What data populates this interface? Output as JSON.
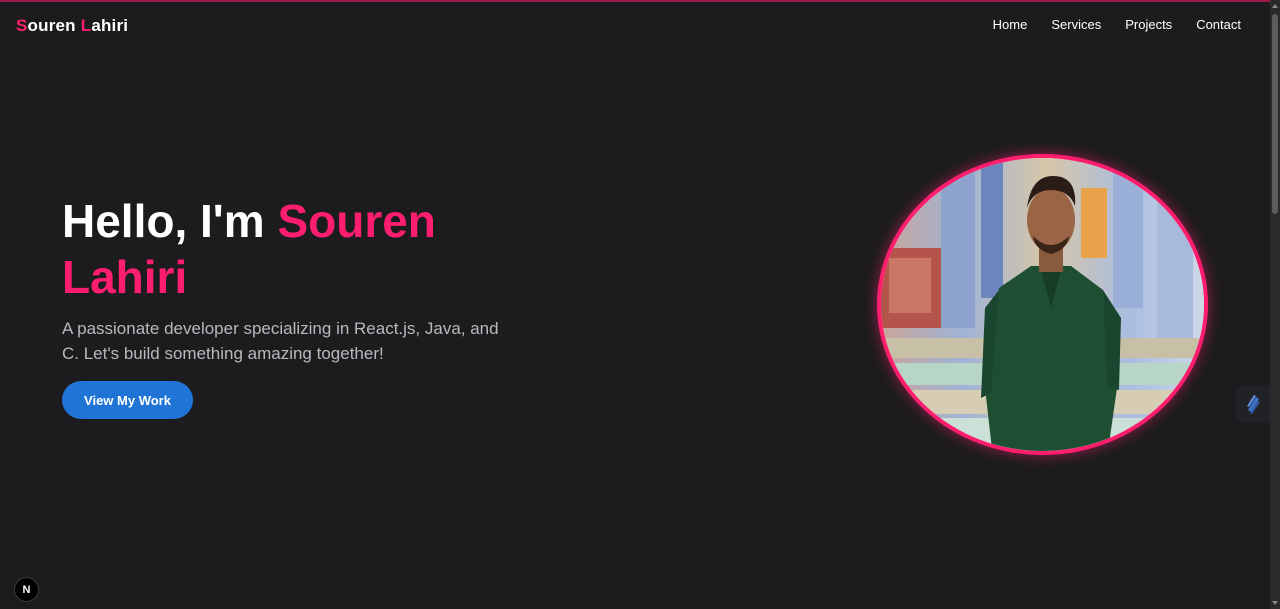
{
  "brand": {
    "first_initial": "S",
    "first_rest": "ouren",
    "last_initial": "L",
    "last_rest": "ahiri"
  },
  "nav": {
    "items": [
      {
        "label": "Home"
      },
      {
        "label": "Services"
      },
      {
        "label": "Projects"
      },
      {
        "label": "Contact"
      }
    ]
  },
  "hero": {
    "greeting": "Hello, I'm",
    "name_first": "Souren",
    "name_last": "Lahiri",
    "subtitle": "A passionate developer specializing in React.js, Java, and C. Let's build something amazing together!",
    "cta_label": "View My Work",
    "portrait_alt": "Souren Lahiri"
  },
  "dev_badge": {
    "letter": "N"
  },
  "colors": {
    "background": "#1c1c1e",
    "accent": "#ff1e6d",
    "button": "#1f74d6",
    "subtitle_text": "#b9b9bd"
  },
  "icons": [
    "portrait-image",
    "pen-icon",
    "dev-badge-icon"
  ]
}
